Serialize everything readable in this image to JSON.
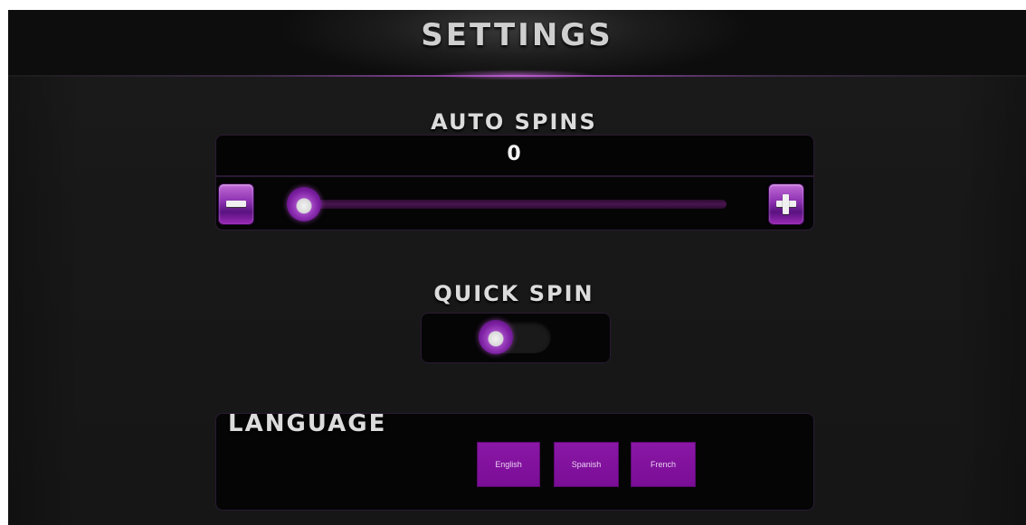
{
  "header": {
    "title": "SETTINGS"
  },
  "auto_spins": {
    "label": "AUTO SPINS",
    "value": "0",
    "slider_fraction": 0,
    "decrement_icon": "minus-icon",
    "increment_icon": "plus-icon"
  },
  "quick_spin": {
    "label": "QUICK SPIN",
    "enabled": false
  },
  "language": {
    "label": "LANGUAGE",
    "options": [
      "English",
      "Spanish",
      "French"
    ]
  },
  "colors": {
    "accent": "#8a17a6",
    "background": "#1a1a1a",
    "panel": "#050505",
    "text": "#dcdcdc"
  }
}
